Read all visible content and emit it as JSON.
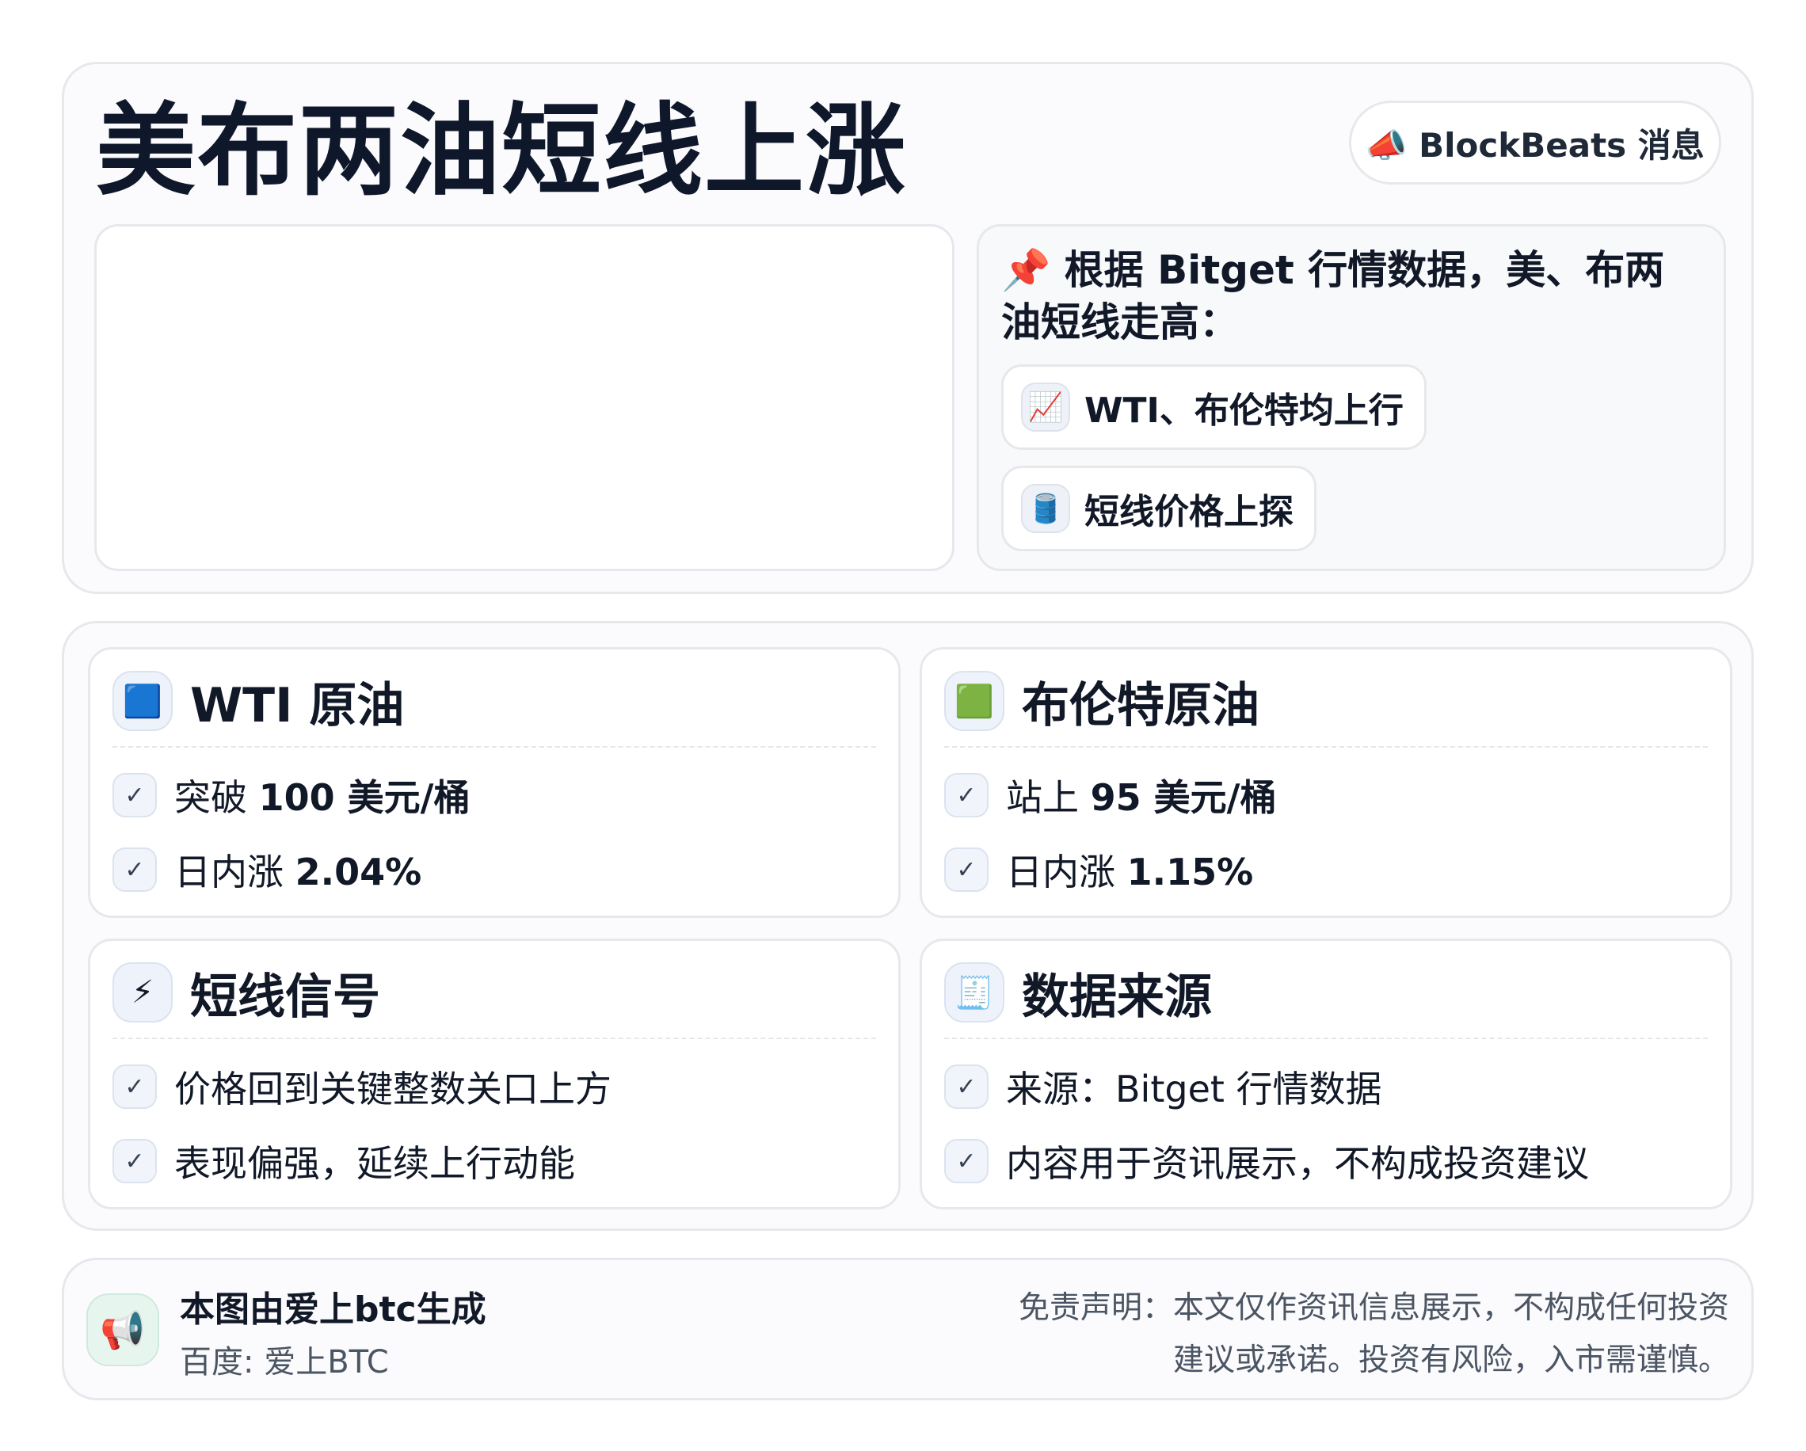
{
  "header": {
    "title": "美布两油短线上涨",
    "badge_icon": "megaphone-icon",
    "badge_label": "📣 BlockBeats 消息"
  },
  "summary": {
    "heading": "📌 根据 Bitget 行情数据，美、布两油短线走高：",
    "chips": [
      {
        "icon": "chart-increasing-icon",
        "glyph": "📈",
        "label": "WTI、布伦特均上行"
      },
      {
        "icon": "oil-drum-icon",
        "glyph": "🛢️",
        "label": "短线价格上探"
      }
    ]
  },
  "cards": {
    "wti": {
      "icon": "blue-square-icon",
      "glyph": "🟦",
      "title": "WTI 原油",
      "items": [
        {
          "prefix": "突破 ",
          "value": "100 美元/桶"
        },
        {
          "prefix": "日内涨 ",
          "value": "2.04%"
        }
      ]
    },
    "brent": {
      "icon": "green-square-icon",
      "glyph": "🟩",
      "title": "布伦特原油",
      "items": [
        {
          "prefix": "站上 ",
          "value": "95 美元/桶"
        },
        {
          "prefix": "日内涨 ",
          "value": "1.15%"
        }
      ]
    },
    "signal": {
      "icon": "lightning-icon",
      "glyph": "⚡",
      "title": "短线信号",
      "items": [
        {
          "text": "价格回到关键整数关口上方"
        },
        {
          "text": "表现偏强，延续上行动能"
        }
      ]
    },
    "source": {
      "icon": "receipt-icon",
      "glyph": "🧾",
      "title": "数据来源",
      "items": [
        {
          "text": "来源：Bitget 行情数据"
        },
        {
          "text": "内容用于资讯展示，不构成投资建议"
        }
      ]
    }
  },
  "footer": {
    "icon": "loudspeaker-icon",
    "glyph": "📢",
    "title": "本图由爱上btc生成",
    "subtitle": "百度: 爱上BTC",
    "disclaimer_line1": "免责声明：本文仅作资讯信息展示，不构成任何投资",
    "disclaimer_line2": "建议或承诺。投资有风险，入市需谨慎。"
  },
  "check_glyph": "✓"
}
